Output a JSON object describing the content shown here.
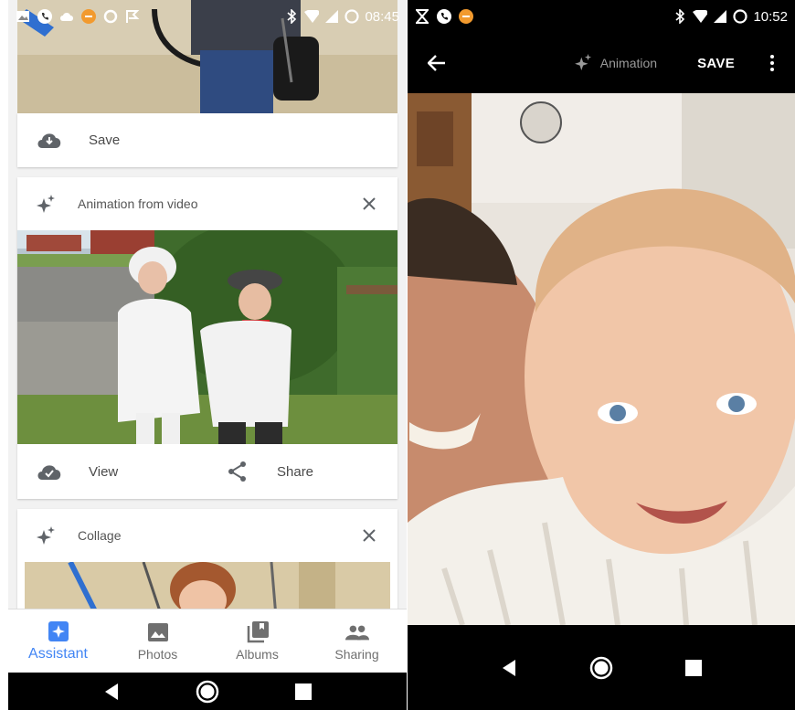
{
  "left": {
    "status_time": "08:45",
    "save_card": {
      "label": "Save",
      "icon": "cloud-download-icon"
    },
    "animation_card": {
      "title": "Animation from video",
      "icon": "sparkle-icon",
      "view_label": "View",
      "share_label": "Share"
    },
    "collage_card": {
      "title": "Collage",
      "icon": "sparkle-icon"
    },
    "bottom_nav": {
      "assistant": "Assistant",
      "photos": "Photos",
      "albums": "Albums",
      "sharing": "Sharing"
    }
  },
  "right": {
    "status_time": "10:52",
    "animation_label": "Animation",
    "save_label": "SAVE"
  },
  "colors": {
    "accent": "#4285f4",
    "status_orange": "#f29a2e"
  }
}
